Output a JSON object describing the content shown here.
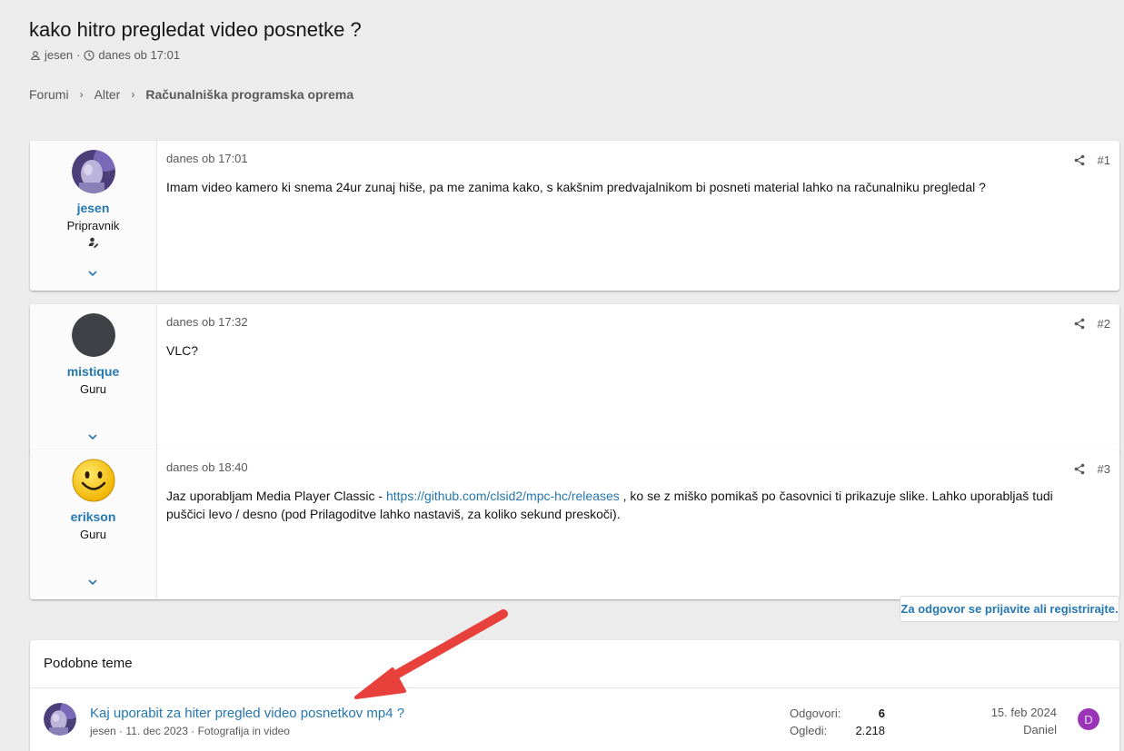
{
  "thread": {
    "title": "kako hitro pregledat video posnetke ?",
    "author": "jesen",
    "separator": "·",
    "started": "danes ob 17:01"
  },
  "breadcrumb": [
    "Forumi",
    "Alter",
    "Računalniška programska oprema"
  ],
  "posts": [
    {
      "user": "jesen",
      "user_title": "Pripravnik",
      "date": "danes ob 17:01",
      "number": "#1",
      "text": "Imam video kamero ki snema 24ur zunaj hiše, pa me zanima kako, s kakšnim predvajalnikom bi posneti material lahko na računalniku pregledal ?"
    },
    {
      "user": "mistique",
      "user_title": "Guru",
      "date": "danes ob 17:32",
      "number": "#2",
      "text": "VLC?"
    },
    {
      "user": "erikson",
      "user_title": "Guru",
      "date": "danes ob 18:40",
      "number": "#3",
      "text_before": "Jaz uporabljam Media Player Classic - ",
      "link": "https://github.com/clsid2/mpc-hc/releases",
      "text_after": " , ko se z miško pomikaš po časovnici ti prikazuje slike. Lahko uporabljaš tudi puščici levo / desno (pod Prilagoditve lahko nastaviš, za koliko sekund preskoči)."
    }
  ],
  "login_prompt": "Za odgovor se prijavite ali registrirajte.",
  "similar": {
    "heading": "Podobne teme",
    "threads": [
      {
        "title": "Kaj uporabit za hiter pregled video posnetkov mp4 ?",
        "author": "jesen",
        "date": "11. dec 2023",
        "forum": "Fotografija in video",
        "replies_label": "Odgovori:",
        "replies": "6",
        "views_label": "Ogledi:",
        "views": "2.218",
        "last_date": "15. feb 2024",
        "last_user": "Daniel",
        "last_avatar_letter": "D"
      }
    ]
  },
  "colors": {
    "link": "#2577b1",
    "annotation_arrow": "#e8403a",
    "avatar_d": "#9b35b8"
  }
}
